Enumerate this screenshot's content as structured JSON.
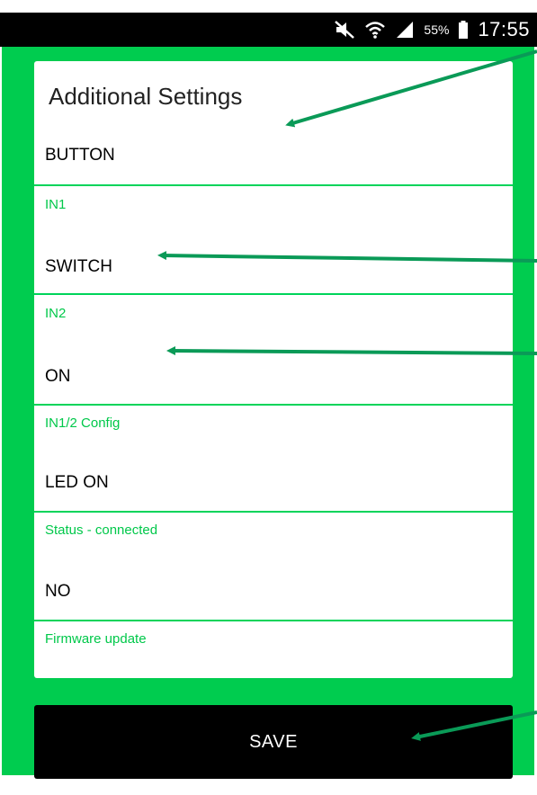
{
  "status_bar": {
    "battery_percent": "55%",
    "time": "17:55",
    "icons": [
      "mute-icon",
      "wifi-icon",
      "signal-icon",
      "battery-icon"
    ]
  },
  "settings": {
    "title": "Additional Settings",
    "rows": [
      {
        "value": "BUTTON",
        "label": "IN1"
      },
      {
        "value": "SWITCH",
        "label": "IN2"
      },
      {
        "value": "ON",
        "label": "IN1/2 Config"
      },
      {
        "value": "LED ON",
        "label": "Status - connected"
      },
      {
        "value": "NO",
        "label": "Firmware update"
      }
    ]
  },
  "actions": {
    "save_label": "SAVE"
  },
  "colors": {
    "accent_green": "#00cc4f",
    "label_green": "#00c84a",
    "status_bar": "#000000",
    "button": "#000000"
  }
}
